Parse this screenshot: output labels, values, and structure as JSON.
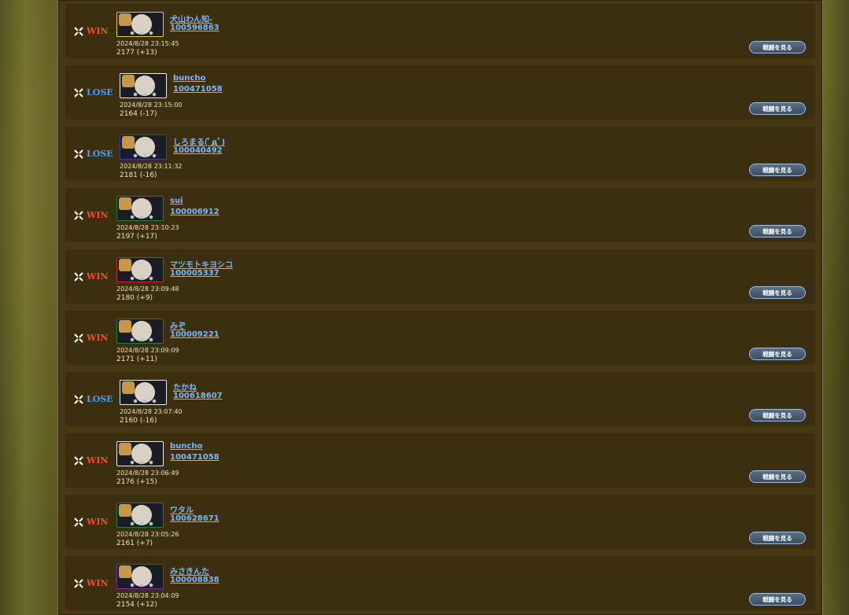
{
  "colors": {
    "win": "#ff4a1a",
    "lose": "#4f9cff",
    "link": "#79b8ff",
    "row_bg": "#3c2f0f",
    "panel_bg": "#473814"
  },
  "icons": {
    "result": "crossed-swords-icon"
  },
  "button_label": "戦闘を見る",
  "matches": [
    {
      "result": "WIN",
      "frame": "gold",
      "player_name": "犬山わん知-",
      "player_id": "100596863",
      "datetime": "2024/8/28 23:15:45",
      "rating": "2177 (+13)"
    },
    {
      "result": "LOSE",
      "frame": "white",
      "player_name": "buncho",
      "player_id": "100471058",
      "datetime": "2024/8/28 23:15:00",
      "rating": "2164 (-17)"
    },
    {
      "result": "LOSE",
      "frame": "navy",
      "player_name": "しろまる(ﾟдﾟ)",
      "player_id": "100040492",
      "datetime": "2024/8/28 23:11:32",
      "rating": "2181 (-16)"
    },
    {
      "result": "WIN",
      "frame": "green",
      "player_name": "sui",
      "player_id": "100006912",
      "datetime": "2024/8/28 23:10:23",
      "rating": "2197 (+17)"
    },
    {
      "result": "WIN",
      "frame": "red",
      "player_name": "マツモトキヨシコ",
      "player_id": "100005337",
      "datetime": "2024/8/28 23:09:48",
      "rating": "2180 (+9)"
    },
    {
      "result": "WIN",
      "frame": "green",
      "player_name": "みぞ",
      "player_id": "100009221",
      "datetime": "2024/8/28 23:09:09",
      "rating": "2171 (+11)"
    },
    {
      "result": "LOSE",
      "frame": "white",
      "player_name": "たかね",
      "player_id": "100618607",
      "datetime": "2024/8/28 23:07:40",
      "rating": "2160 (-16)"
    },
    {
      "result": "WIN",
      "frame": "white",
      "player_name": "buncho",
      "player_id": "100471058",
      "datetime": "2024/8/28 23:06:49",
      "rating": "2176 (+15)"
    },
    {
      "result": "WIN",
      "frame": "green",
      "player_name": "ワタル",
      "player_id": "100628671",
      "datetime": "2024/8/28 23:05:26",
      "rating": "2161 (+7)"
    },
    {
      "result": "WIN",
      "frame": "purple",
      "player_name": "みさきんた",
      "player_id": "100008838",
      "datetime": "2024/8/28 23:04:09",
      "rating": "2154 (+12)"
    }
  ]
}
